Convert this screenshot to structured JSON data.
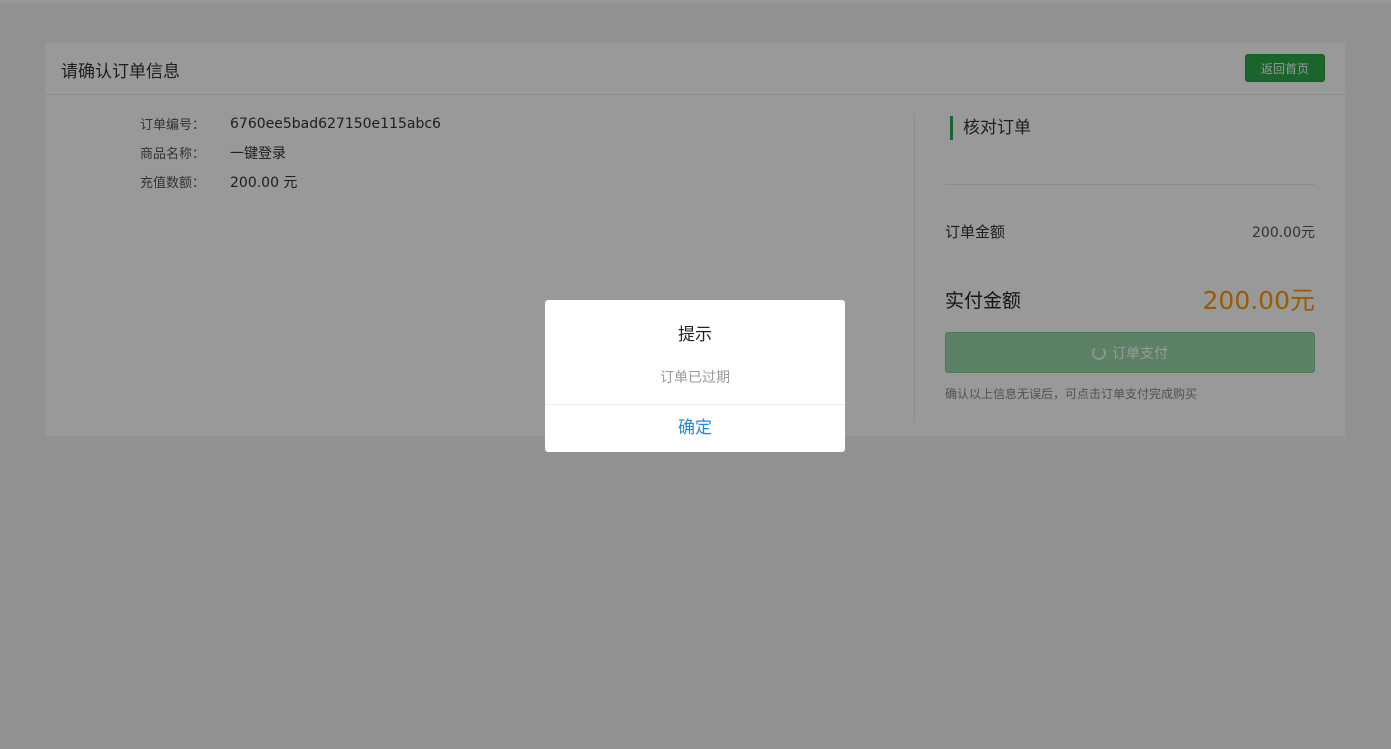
{
  "header": {
    "title": "请确认订单信息",
    "home_button": "返回首页"
  },
  "order_info": {
    "rows": [
      {
        "label": "订单编号：",
        "value": "6760ee5bad627150e115abc6"
      },
      {
        "label": "商品名称：",
        "value": "一键登录"
      },
      {
        "label": "充值数额：",
        "value": "200.00 元"
      }
    ]
  },
  "verify": {
    "title": "核对订单",
    "order_amount_label": "订单金额",
    "order_amount_value": "200.00元",
    "paid_label": "实付金额",
    "paid_value": "200.00元",
    "pay_button": "订单支付",
    "hint": "确认以上信息无误后，可点击订单支付完成购买"
  },
  "modal": {
    "title": "提示",
    "message": "订单已过期",
    "confirm": "确定"
  },
  "colors": {
    "accent_green": "#2aa84a",
    "price_orange": "#ff9900",
    "confirm_blue": "#1e88e5"
  }
}
